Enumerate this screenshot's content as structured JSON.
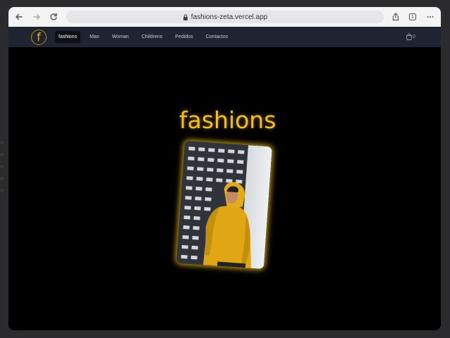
{
  "browser": {
    "url": "fashions-zeta.vercel.app",
    "tab_count": "1"
  },
  "site_nav": {
    "logo_letter": "f",
    "items": [
      {
        "label": "fashions",
        "active": true
      },
      {
        "label": "Man",
        "active": false
      },
      {
        "label": "Woman",
        "active": false
      },
      {
        "label": "Childrens",
        "active": false
      },
      {
        "label": "Pedidos",
        "active": false
      },
      {
        "label": "Contactos",
        "active": false
      }
    ],
    "cart_count": "0"
  },
  "hero": {
    "title": "fashions",
    "image_icon": "photo-man-yellow-hoodie"
  },
  "colors": {
    "accent": "#f2bf1c",
    "nav_bg": "#1f2433",
    "page_bg": "#000000"
  }
}
